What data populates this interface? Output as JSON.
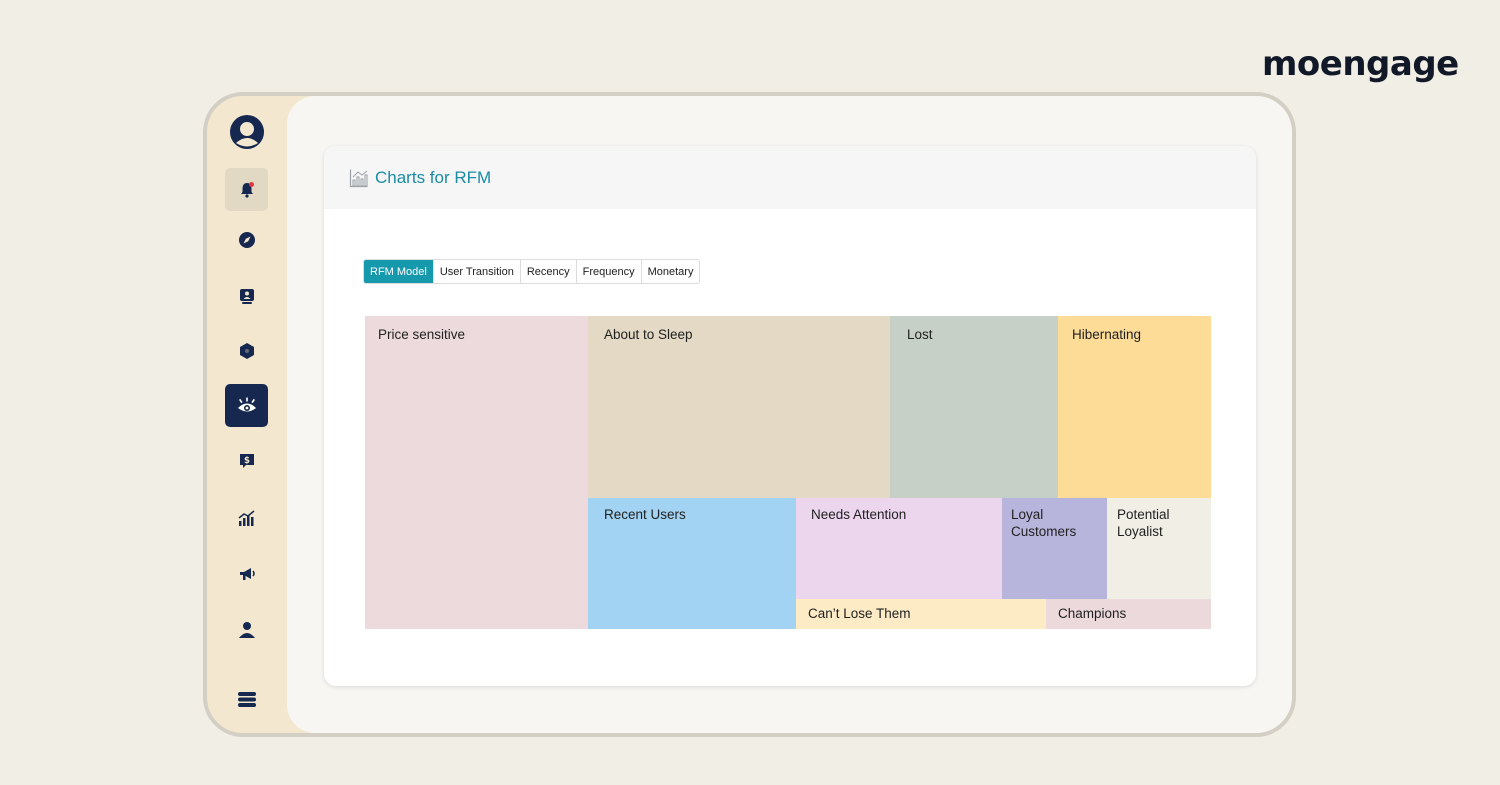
{
  "brand": {
    "logo_text": "moengage"
  },
  "sidebar": {
    "items": [
      {
        "name": "notifications",
        "icon": "bell-icon"
      },
      {
        "name": "explore",
        "icon": "compass-icon"
      },
      {
        "name": "profile-card",
        "icon": "id-badge-icon"
      },
      {
        "name": "segments",
        "icon": "hexagon-icon"
      },
      {
        "name": "insights",
        "icon": "eye-icon",
        "active": true
      },
      {
        "name": "revenue",
        "icon": "dollar-chat-icon"
      },
      {
        "name": "analytics",
        "icon": "bar-chart-icon"
      },
      {
        "name": "campaigns",
        "icon": "megaphone-icon"
      },
      {
        "name": "users",
        "icon": "user-icon"
      },
      {
        "name": "data",
        "icon": "database-icon"
      }
    ]
  },
  "panel": {
    "title": "Charts for RFM",
    "title_icon": "chart-icon"
  },
  "tabs": [
    {
      "label": "RFM Model",
      "active": true
    },
    {
      "label": "User Transition"
    },
    {
      "label": "Recency"
    },
    {
      "label": "Frequency"
    },
    {
      "label": "Monetary"
    }
  ],
  "treemap": {
    "segments": [
      {
        "label": "Price sensitive",
        "color": "#ecdadc"
      },
      {
        "label": "About to Sleep",
        "color": "#e3d9c5"
      },
      {
        "label": "Lost",
        "color": "#c6d0c6"
      },
      {
        "label": "Hibernating",
        "color": "#fcdc97"
      },
      {
        "label": "Recent Users",
        "color": "#a3d3f3"
      },
      {
        "label": "Needs Attention",
        "color": "#ebd6ee"
      },
      {
        "label": "Loyal Customers",
        "color": "#b8b5dd"
      },
      {
        "label": "Potential Loyalist",
        "color": "#f1eee6"
      },
      {
        "label": "Can’t Lose Them",
        "color": "#fdebc6"
      },
      {
        "label": "Champions",
        "color": "#ecd9dc"
      }
    ]
  },
  "colors": {
    "accent": "#1799ad",
    "nav_active": "#16284f",
    "icon": "#16284f"
  }
}
